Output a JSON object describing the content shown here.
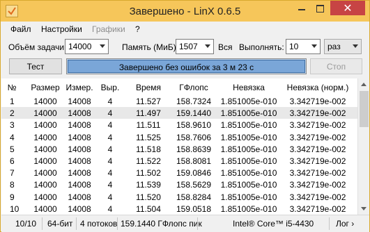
{
  "window": {
    "title": "Завершено - LinX 0.6.5",
    "close_glyph": "✕"
  },
  "menu": [
    "Файл",
    "Настройки",
    "Графики",
    "?"
  ],
  "controls": {
    "problem_size_label": "Объём задачи:",
    "problem_size_value": "14000",
    "memory_label": "Память (МиБ):",
    "memory_value": "1507",
    "all_label": "Вся",
    "runs_label": "Выполнять:",
    "runs_value": "10",
    "runs_unit": "раз",
    "test_button": "Тест",
    "stop_button": "Стоп",
    "progress_text": "Завершено без ошибок за 3 м 23 с",
    "progress_percent": 100
  },
  "table": {
    "columns": [
      "№",
      "Размер",
      "Измер.",
      "Выр.",
      "Время",
      "ГФлопс",
      "Невязка",
      "Невязка (норм.)"
    ],
    "rows": [
      [
        "1",
        "14000",
        "14008",
        "4",
        "11.527",
        "158.7324",
        "1.851005e-010",
        "3.342719e-002"
      ],
      [
        "2",
        "14000",
        "14008",
        "4",
        "11.497",
        "159.1440",
        "1.851005e-010",
        "3.342719e-002"
      ],
      [
        "3",
        "14000",
        "14008",
        "4",
        "11.511",
        "158.9610",
        "1.851005e-010",
        "3.342719e-002"
      ],
      [
        "4",
        "14000",
        "14008",
        "4",
        "11.525",
        "158.7606",
        "1.851005e-010",
        "3.342719e-002"
      ],
      [
        "5",
        "14000",
        "14008",
        "4",
        "11.518",
        "158.8639",
        "1.851005e-010",
        "3.342719e-002"
      ],
      [
        "6",
        "14000",
        "14008",
        "4",
        "11.522",
        "158.8081",
        "1.851005e-010",
        "3.342719e-002"
      ],
      [
        "7",
        "14000",
        "14008",
        "4",
        "11.502",
        "159.0846",
        "1.851005e-010",
        "3.342719e-002"
      ],
      [
        "8",
        "14000",
        "14008",
        "4",
        "11.539",
        "158.5629",
        "1.851005e-010",
        "3.342719e-002"
      ],
      [
        "9",
        "14000",
        "14008",
        "4",
        "11.520",
        "158.8284",
        "1.851005e-010",
        "3.342719e-002"
      ],
      [
        "10",
        "14000",
        "14008",
        "4",
        "11.504",
        "159.0518",
        "1.851005e-010",
        "3.342719e-002"
      ]
    ],
    "selected_row": 2
  },
  "status": {
    "progress": "10/10",
    "bits": "64-бит",
    "threads": "4 потоков",
    "peak": "159.1440 ГФлопс пик",
    "cpu": "Intel® Core™ i5-4430",
    "log": "Лог ›"
  },
  "colors": {
    "titlebar": "#f6c65a",
    "close_button": "#c74444",
    "progress_fill": "#7aa6d8"
  }
}
